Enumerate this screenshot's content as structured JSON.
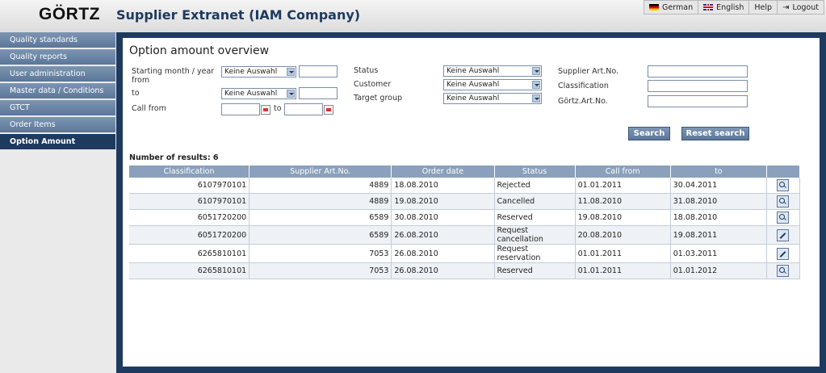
{
  "header": {
    "logo": "GÖRTZ",
    "title": "Supplier Extranet (IAM Company)"
  },
  "topnav": {
    "german": "German",
    "english": "English",
    "help": "Help",
    "logout": "Logout"
  },
  "sidebar": {
    "items": [
      {
        "label": "Quality standards"
      },
      {
        "label": "Quality reports"
      },
      {
        "label": "User administration"
      },
      {
        "label": "Master data / Conditions"
      },
      {
        "label": "GTCT"
      },
      {
        "label": "Order Items"
      },
      {
        "label": "Option Amount"
      }
    ]
  },
  "main": {
    "title": "Option amount overview",
    "filters": {
      "starting_label": "Starting month / year from",
      "to_label": "to",
      "call_from_label": "Call from",
      "call_to_label": "to",
      "status_label": "Status",
      "customer_label": "Customer",
      "target_group_label": "Target group",
      "supplier_artno_label": "Supplier Art.No.",
      "classification_label": "Classification",
      "goertz_artno_label": "Görtz.Art.No.",
      "select_default": "Keine Auswahl"
    },
    "buttons": {
      "search": "Search",
      "reset": "Reset search"
    },
    "results_count": "Number of results: 6",
    "columns": [
      "Classification",
      "Supplier Art.No.",
      "Order date",
      "Status",
      "Call from",
      "to"
    ],
    "rows": [
      {
        "classification": "6107970101",
        "supplier": "4889",
        "order_date": "18.08.2010",
        "status": "Rejected",
        "call_from": "01.01.2011",
        "to": "30.04.2011",
        "action": "view"
      },
      {
        "classification": "6107970101",
        "supplier": "4889",
        "order_date": "19.08.2010",
        "status": "Cancelled",
        "call_from": "11.08.2010",
        "to": "31.08.2010",
        "action": "view"
      },
      {
        "classification": "6051720200",
        "supplier": "6589",
        "order_date": "30.08.2010",
        "status": "Reserved",
        "call_from": "19.08.2010",
        "to": "18.08.2010",
        "action": "view"
      },
      {
        "classification": "6051720200",
        "supplier": "6589",
        "order_date": "26.08.2010",
        "status": "Request cancellation",
        "call_from": "20.08.2010",
        "to": "19.08.2011",
        "action": "edit"
      },
      {
        "classification": "6265810101",
        "supplier": "7053",
        "order_date": "26.08.2010",
        "status": "Request reservation",
        "call_from": "01.01.2011",
        "to": "01.03.2011",
        "action": "edit"
      },
      {
        "classification": "6265810101",
        "supplier": "7053",
        "order_date": "26.08.2010",
        "status": "Reserved",
        "call_from": "01.01.2011",
        "to": "01.01.2012",
        "action": "view"
      }
    ]
  }
}
